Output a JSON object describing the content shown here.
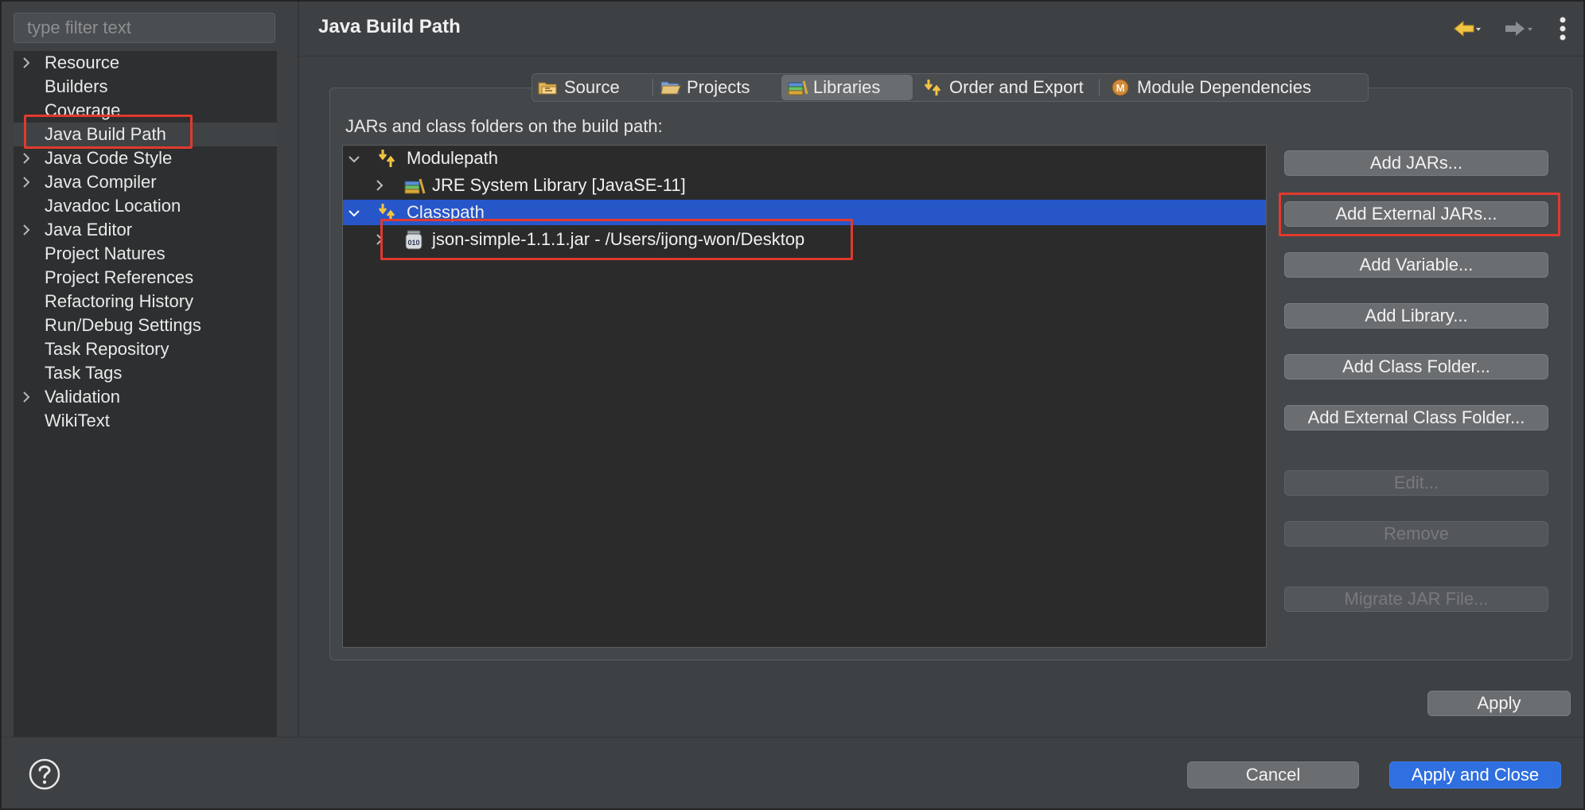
{
  "filter": {
    "placeholder": "type filter text"
  },
  "nav": {
    "items": [
      {
        "label": "Resource",
        "expandable": true
      },
      {
        "label": "Builders",
        "expandable": false
      },
      {
        "label": "Coverage",
        "expandable": false
      },
      {
        "label": "Java Build Path",
        "expandable": false,
        "selected": true
      },
      {
        "label": "Java Code Style",
        "expandable": true
      },
      {
        "label": "Java Compiler",
        "expandable": true
      },
      {
        "label": "Javadoc Location",
        "expandable": false
      },
      {
        "label": "Java Editor",
        "expandable": true
      },
      {
        "label": "Project Natures",
        "expandable": false
      },
      {
        "label": "Project References",
        "expandable": false
      },
      {
        "label": "Refactoring History",
        "expandable": false
      },
      {
        "label": "Run/Debug Settings",
        "expandable": false
      },
      {
        "label": "Task Repository",
        "expandable": false
      },
      {
        "label": "Task Tags",
        "expandable": false
      },
      {
        "label": "Validation",
        "expandable": true
      },
      {
        "label": "WikiText",
        "expandable": false
      }
    ]
  },
  "header": {
    "title": "Java Build Path"
  },
  "tabs": [
    {
      "label": "Source",
      "icon": "source-folder-icon"
    },
    {
      "label": "Projects",
      "icon": "projects-folder-icon"
    },
    {
      "label": "Libraries",
      "icon": "libraries-icon",
      "active": true
    },
    {
      "label": "Order and Export",
      "icon": "order-export-icon"
    },
    {
      "label": "Module Dependencies",
      "icon": "module-icon"
    }
  ],
  "panel": {
    "label": "JARs and class folders on the build path:",
    "tree": [
      {
        "label": "Modulepath",
        "icon": "buildpath-icon",
        "expanded": true
      },
      {
        "label": "JRE System Library [JavaSE-11]",
        "icon": "library-icon",
        "expanded": false
      },
      {
        "label": "Classpath",
        "icon": "buildpath-icon",
        "expanded": true,
        "selected": true
      },
      {
        "label": "json-simple-1.1.1.jar - /Users/ijong-won/Desktop",
        "icon": "jar-icon",
        "expanded": false
      }
    ]
  },
  "buttons": {
    "add_jars": "Add JARs...",
    "add_external_jars": "Add External JARs...",
    "add_variable": "Add Variable...",
    "add_library": "Add Library...",
    "add_class_folder": "Add Class Folder...",
    "add_external_class_folder": "Add External Class Folder...",
    "edit": "Edit...",
    "remove": "Remove",
    "migrate_jar": "Migrate JAR File...",
    "apply": "Apply",
    "cancel": "Cancel",
    "apply_and_close": "Apply and Close"
  },
  "colors": {
    "highlight": "#e13a2e",
    "selection": "#2756c9",
    "primary_button": "#2f6fe0"
  }
}
